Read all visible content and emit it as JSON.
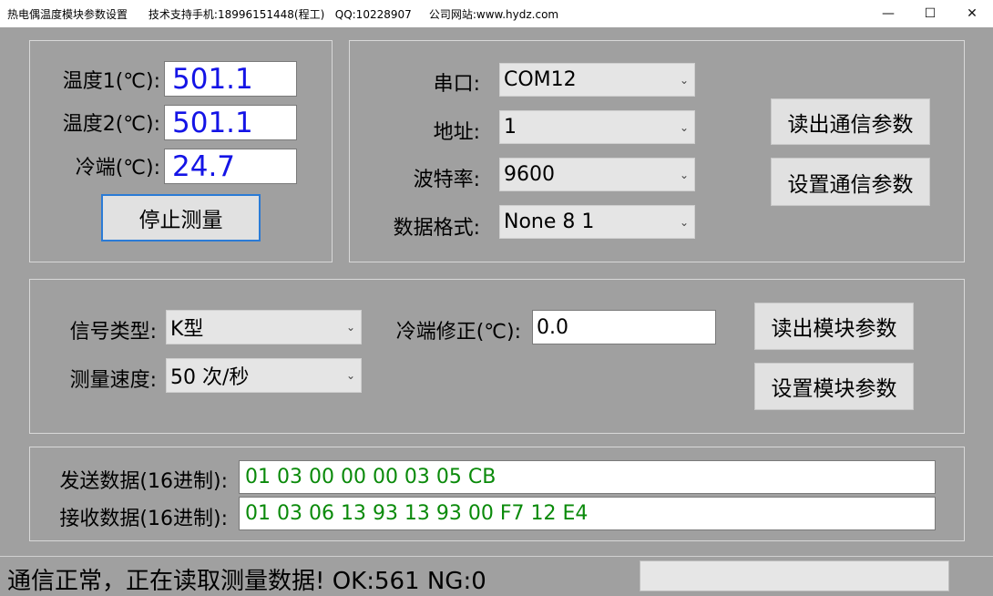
{
  "window": {
    "title": "热电偶温度模块参数设置",
    "support": "技术支持手机:18996151448(程工)",
    "qq": "QQ:10228907",
    "website": "公司网站:www.hydz.com",
    "minimize": "—",
    "maximize": "☐",
    "close": "✕"
  },
  "measure": {
    "temp1_label": "温度1(℃):",
    "temp1_value": "501.1",
    "temp2_label": "温度2(℃):",
    "temp2_value": "501.1",
    "cold_label": "冷端(℃):",
    "cold_value": "24.7",
    "stop_button": "停止测量"
  },
  "comm": {
    "port_label": "串口:",
    "port_value": "COM12",
    "address_label": "地址:",
    "address_value": "1",
    "baud_label": "波特率:",
    "baud_value": "9600",
    "format_label": "数据格式:",
    "format_value": "None 8 1",
    "read_button": "读出通信参数",
    "set_button": "设置通信参数"
  },
  "module": {
    "signal_label": "信号类型:",
    "signal_value": "K型",
    "speed_label": "测量速度:",
    "speed_value": "50 次/秒",
    "cold_fix_label": "冷端修正(℃):",
    "cold_fix_value": "0.0",
    "read_button": "读出模块参数",
    "set_button": "设置模块参数"
  },
  "data": {
    "send_label": "发送数据(16进制):",
    "send_value": "01 03 00 00 00 03 05 CB",
    "recv_label": "接收数据(16进制):",
    "recv_value": "01 03 06 13 93 13 93 00 F7 12 E4"
  },
  "status": {
    "text": "通信正常，正在读取测量数据!  OK:561   NG:0",
    "progress": 0
  },
  "colors": {
    "background": "#a0a0a0",
    "value_blue": "#1414e6",
    "hex_green": "#0a8a0a",
    "focus_border": "#2b7bd6"
  },
  "icons": {
    "combo": "chevron-down-icon"
  }
}
